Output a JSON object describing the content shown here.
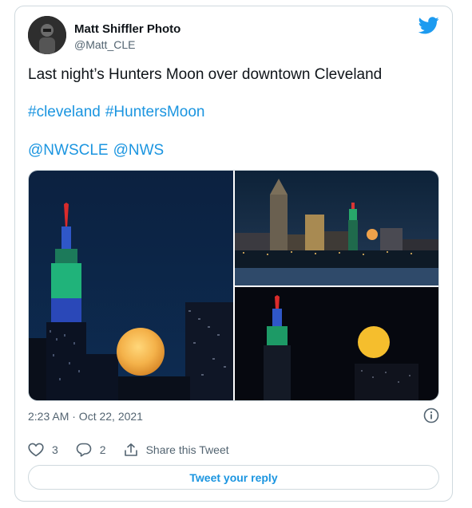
{
  "author": {
    "display_name": "Matt Shiffler Photo",
    "handle": "@Matt_CLE"
  },
  "tweet": {
    "text": "Last night’s Hunters Moon over downtown Cleveland",
    "hashtags": [
      "#cleveland",
      "#HuntersMoon"
    ],
    "mentions": [
      "@NWSCLE",
      "@NWS"
    ],
    "timestamp": "2:23 AM · Oct 22, 2021"
  },
  "actions": {
    "likes": "3",
    "replies": "2",
    "share_label": "Share this Tweet",
    "reply_button": "Tweet your reply"
  },
  "colors": {
    "link": "#1b95e0",
    "text": "#0f1419",
    "muted": "#536471",
    "border": "#cfd9de",
    "twitter_blue": "#1d9bf0"
  },
  "icons": [
    "twitter-bird-icon",
    "info-icon",
    "heart-icon",
    "reply-bubble-icon",
    "share-icon"
  ]
}
